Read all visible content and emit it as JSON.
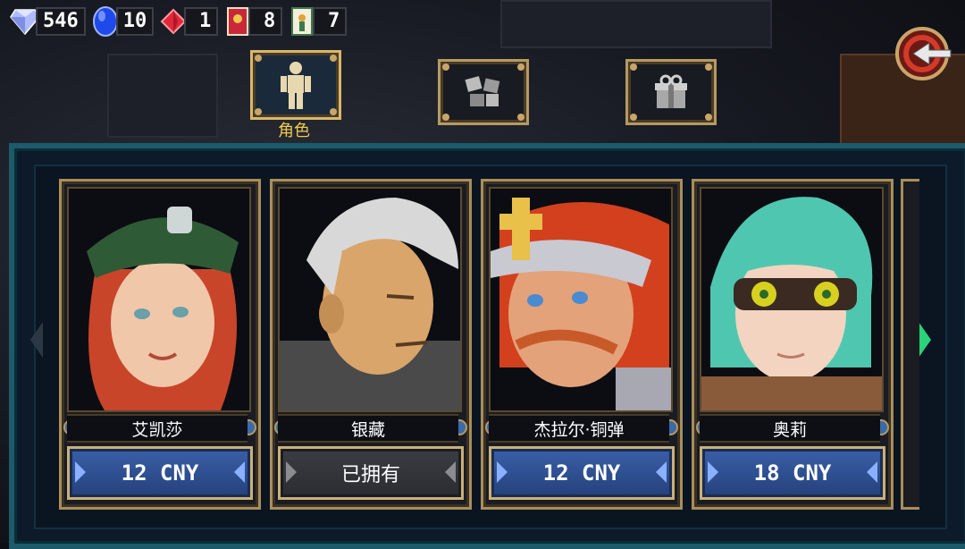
{
  "currencies": [
    {
      "icon": "diamond-icon",
      "value": "546",
      "color": "#b8c7ff"
    },
    {
      "icon": "sapphire-icon",
      "value": "10",
      "color": "#2c5cff"
    },
    {
      "icon": "ruby-icon",
      "value": "1",
      "color": "#e02838"
    },
    {
      "icon": "ticket-icon",
      "value": "8",
      "color": "#c8283a"
    },
    {
      "icon": "tarot-card-icon",
      "value": "7",
      "color": "#3d7a4a"
    }
  ],
  "tabs": [
    {
      "icon": "character-figure-icon",
      "label": "角色",
      "active": true
    },
    {
      "icon": "dice-icon",
      "label": "",
      "active": false
    },
    {
      "icon": "gift-box-icon",
      "label": "",
      "active": false
    }
  ],
  "back": {
    "icon": "back-arrow-icon"
  },
  "characters": [
    {
      "name": "艾凯莎",
      "price": "12 CNY",
      "owned": false,
      "hair": "#c8452a",
      "skin": "#f0c7a8",
      "accent": "#2f5a36"
    },
    {
      "name": "银藏",
      "price": "已拥有",
      "owned": true,
      "hair": "#d8d8d8",
      "skin": "#d9a56a",
      "accent": "#4a4a4a"
    },
    {
      "name": "杰拉尔·铜弹",
      "price": "12 CNY",
      "owned": false,
      "hair": "#d2401e",
      "skin": "#e3a27a",
      "accent": "#c9c9d2"
    },
    {
      "name": "奥莉",
      "price": "18 CNY",
      "owned": false,
      "hair": "#4fc7b0",
      "skin": "#f2d4c0",
      "accent": "#8a5b3a"
    }
  ],
  "nav": {
    "left_icon": "chevron-left-icon",
    "right_icon": "chevron-right-icon"
  }
}
